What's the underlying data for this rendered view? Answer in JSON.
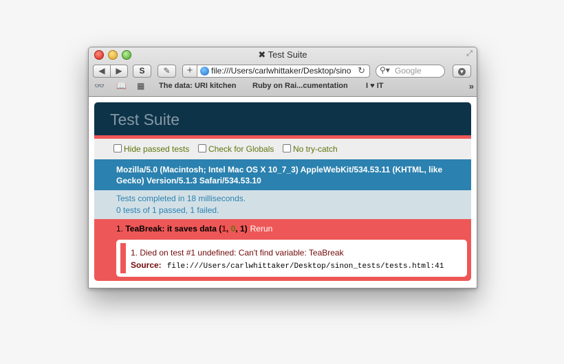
{
  "window": {
    "title": "✖ Test Suite"
  },
  "toolbar": {
    "back_icon": "◀",
    "forward_icon": "▶",
    "s_label": "S",
    "plus_label": "+",
    "url": "file:///Users/carlwhittaker/Desktop/sinon_tests/tests.html",
    "search_placeholder": "Google",
    "reload_icon": "↻"
  },
  "bookmarks": {
    "items": [
      "The data: URI kitchen",
      "Ruby on Rai...cumentation",
      "I ♥ IT"
    ],
    "more": "»"
  },
  "page": {
    "title": "Test Suite",
    "options": [
      "Hide passed tests",
      "Check for Globals",
      "No try-catch"
    ],
    "user_agent": "Mozilla/5.0 (Macintosh; Intel Mac OS X 10_7_3) AppleWebKit/534.53.11 (KHTML, like Gecko) Version/5.1.3 Safari/534.53.10",
    "result_line1": "Tests completed in 18 milliseconds.",
    "result_line2": "0 tests of 1 passed, 1 failed.",
    "test": {
      "number": "1.",
      "name": "TeaBreak: it saves data",
      "open": " (",
      "failed": "1",
      "sep1": ", ",
      "passed": "0",
      "sep2": ", ",
      "total": "1",
      "close": ")",
      "rerun": "Rerun",
      "message": "1. Died on test #1 undefined: Can't find variable: TeaBreak",
      "source_label": "Source:",
      "source_path": "file:///Users/carlwhittaker/Desktop/sinon_tests/tests.html:41"
    }
  },
  "colors": {
    "header_bg": "#0d3349",
    "fail_bg": "#ee5757",
    "ua_bg": "#2b81af",
    "result_bg": "#d2e0e6"
  }
}
